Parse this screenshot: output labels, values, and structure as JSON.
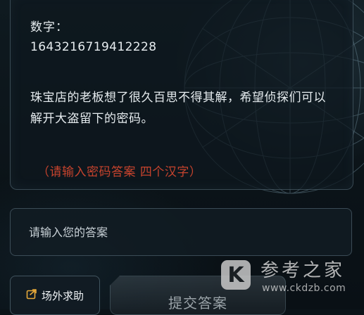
{
  "puzzle": {
    "label": "数字：",
    "digits": "1643216719412228",
    "story": "珠宝店的老板想了很久百思不得其解，希望侦探们可以解开大盗留下的密码。",
    "hint": "（请输入密码答案 四个汉字）"
  },
  "answer": {
    "placeholder": "请输入您的答案",
    "value": ""
  },
  "buttons": {
    "help_label": "场外求助",
    "submit_label": "提交答案"
  },
  "watermark": {
    "logo_letter": "K",
    "title": "参考之家",
    "url": "www.ckdzb.com"
  },
  "icons": {
    "help": "share-arrow-icon"
  },
  "colors": {
    "hint": "#c6432d",
    "background": "#0b1318"
  }
}
